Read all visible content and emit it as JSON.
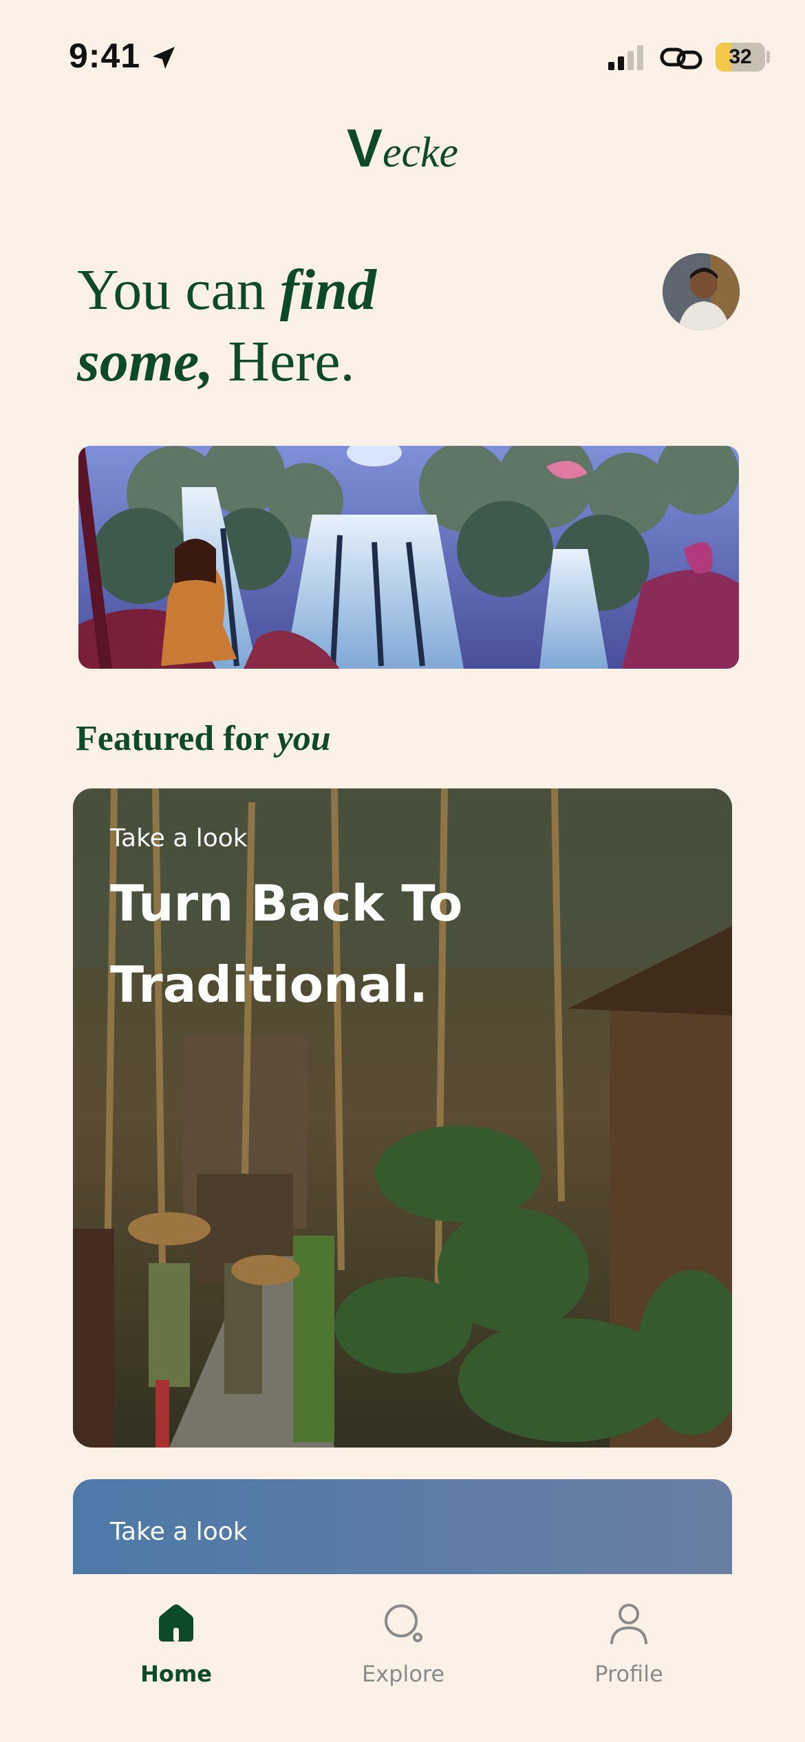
{
  "status_bar": {
    "time": "9:41",
    "battery": "32",
    "battery_level": 0.32,
    "icons": [
      "location-arrow-icon",
      "cellular-signal-icon",
      "link-icon",
      "battery-icon"
    ]
  },
  "app": {
    "logo_mark": "V",
    "logo_text": "ecke"
  },
  "headline": {
    "part1": "You can ",
    "part2_italic": "find",
    "part3_italic": "some,",
    "part4": " Here."
  },
  "featured": {
    "title": "Featured for ",
    "title_italic": "you",
    "cards": [
      {
        "kicker": "Take a look",
        "title": "Turn Back To Traditional."
      },
      {
        "kicker": "Take a look"
      }
    ]
  },
  "tabs": [
    {
      "label": "Home",
      "icon": "home-icon",
      "active": true
    },
    {
      "label": "Explore",
      "icon": "search-icon",
      "active": false
    },
    {
      "label": "Profile",
      "icon": "person-icon",
      "active": false
    }
  ],
  "colors": {
    "background": "#fcf1e7",
    "brand_green": "#0d4a2a",
    "inactive_gray": "#8a8a8a",
    "battery_yellow": "#f2c74a"
  }
}
